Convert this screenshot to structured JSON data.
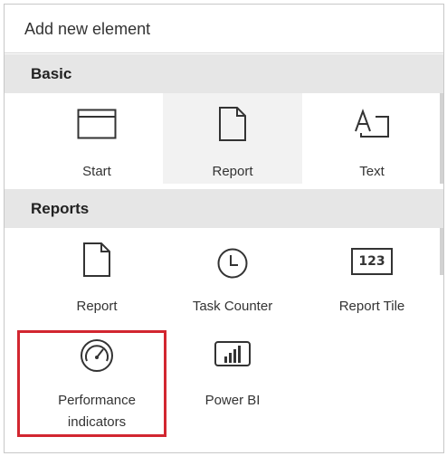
{
  "panel": {
    "title": "Add new element"
  },
  "sections": {
    "basic": {
      "header": "Basic",
      "items": [
        {
          "label": "Start",
          "icon": "window-icon"
        },
        {
          "label": "Report",
          "icon": "document-icon"
        },
        {
          "label": "Text",
          "icon": "text-icon"
        }
      ]
    },
    "reports": {
      "header": "Reports",
      "items": [
        {
          "label": "Report",
          "icon": "document-icon"
        },
        {
          "label": "Task Counter",
          "icon": "clock-icon"
        },
        {
          "label": "Report Tile",
          "icon": "tile-123-icon",
          "glyph": "123"
        },
        {
          "label_line1": "Performance",
          "label_line2": "indicators",
          "icon": "gauge-icon"
        },
        {
          "label": "Power BI",
          "icon": "power-bi-icon"
        }
      ]
    }
  },
  "colors": {
    "highlight": "#d22630",
    "section_bg": "#e6e6e6",
    "selected_bg": "#f2f2f2"
  }
}
